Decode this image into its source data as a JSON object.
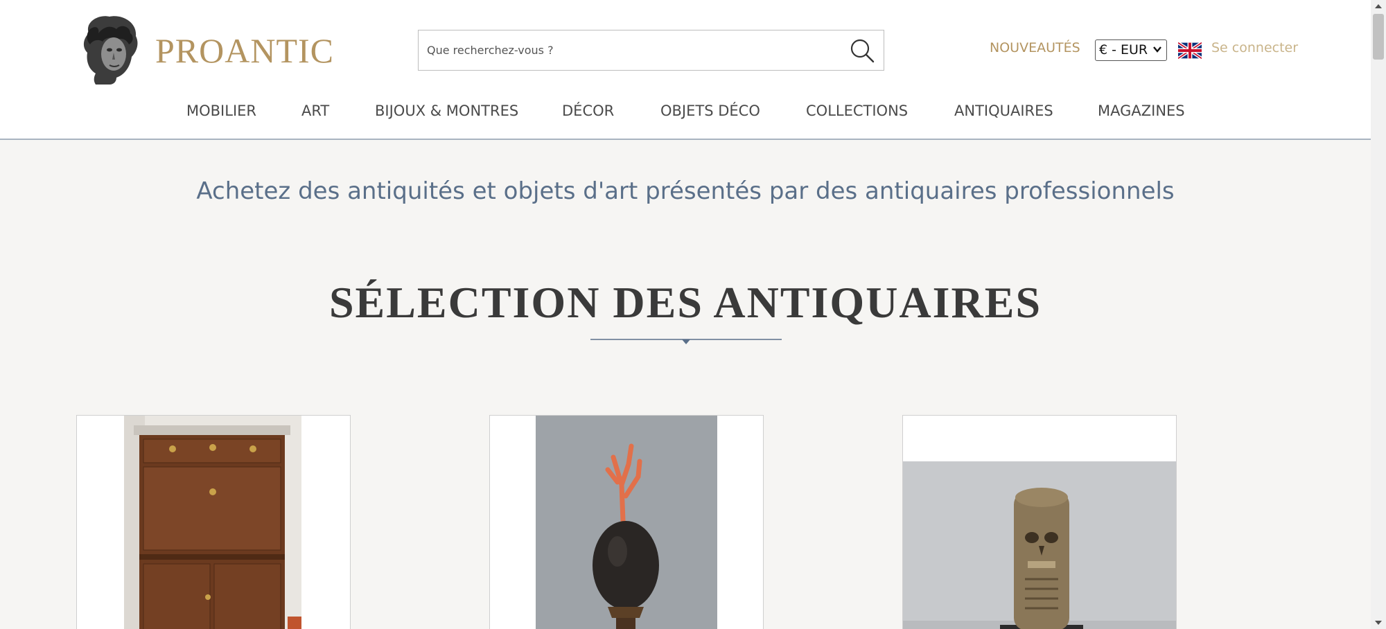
{
  "header": {
    "logo_text": "PROANTIC",
    "search_placeholder": "Que recherchez-vous ?",
    "search_icon": "search-icon",
    "new_link": "NOUVEAUTÉS",
    "currency": "€ - EUR",
    "language_flag_icon": "uk-flag-icon",
    "login_link": "Se connecter",
    "colors": {
      "brand": "#b39460",
      "login": "#c9b48a",
      "nav_text": "#4a4a4a"
    }
  },
  "nav": {
    "items": [
      {
        "label": "MOBILIER"
      },
      {
        "label": "ART"
      },
      {
        "label": "BIJOUX & MONTRES"
      },
      {
        "label": "DÉCOR"
      },
      {
        "label": "OBJETS DÉCO"
      },
      {
        "label": "COLLECTIONS"
      },
      {
        "label": "ANTIQUAIRES"
      },
      {
        "label": "MAGAZINES"
      }
    ]
  },
  "main": {
    "tagline": "Achetez des antiquités et objets d'art présentés par des antiquaires professionnels",
    "section_title": "SÉLECTION DES ANTIQUAIRES",
    "colors": {
      "tagline": "#5a6f89",
      "title": "#3a3a3a"
    }
  }
}
